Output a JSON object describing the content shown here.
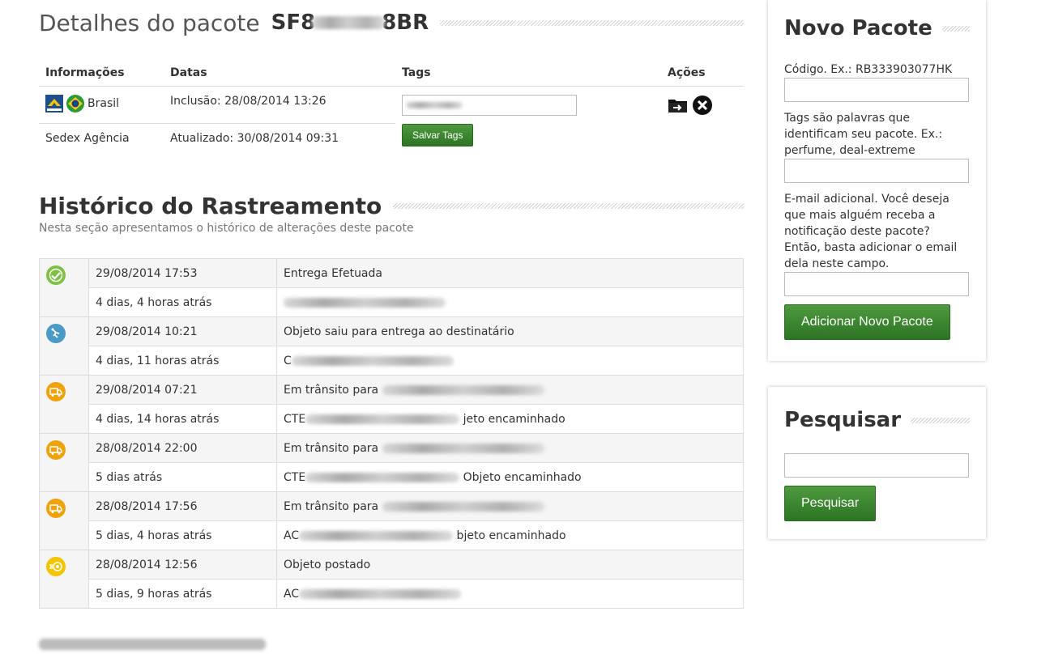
{
  "header": {
    "title": "Detalhes do pacote",
    "code_prefix": "SF8",
    "code_suffix": "8BR"
  },
  "info_table": {
    "headers": [
      "Informações",
      "Datas",
      "Tags",
      "Ações"
    ],
    "country": "Brasil",
    "service": "Sedex Agência",
    "inclusion": "Inclusão: 28/08/2014 13:26",
    "updated": "Atualizado: 30/08/2014 09:31",
    "save_tags_label": "Salvar Tags"
  },
  "history": {
    "title": "Histórico do Rastreamento",
    "subtitle": "Nesta seção apresentamos o histórico de alterações deste pacote",
    "events": [
      {
        "icon": "check-circle-icon",
        "color": "#7cc142",
        "date": "29/08/2014 17:53",
        "status": "Entrega Efetuada",
        "ago": "4 dias, 4 horas atrás",
        "detail_prefix": "",
        "detail_suffix": ""
      },
      {
        "icon": "delivery-person-icon",
        "color": "#4a9ac8",
        "date": "29/08/2014 10:21",
        "status": "Objeto saiu para entrega ao destinatário",
        "ago": "4 dias, 11 horas atrás",
        "detail_prefix": "C",
        "detail_suffix": ""
      },
      {
        "icon": "truck-icon",
        "color": "#f0a20a",
        "date": "29/08/2014 07:21",
        "status": "Em trânsito para",
        "ago": "4 dias, 14 horas atrás",
        "detail_prefix": "CTE",
        "detail_suffix": "jeto encaminhado"
      },
      {
        "icon": "truck-icon",
        "color": "#f0a20a",
        "date": "28/08/2014 22:00",
        "status": "Em trânsito para",
        "ago": "5 dias atrás",
        "detail_prefix": "CTE",
        "detail_suffix": "Objeto encaminhado"
      },
      {
        "icon": "truck-icon",
        "color": "#f0a20a",
        "date": "28/08/2014 17:56",
        "status": "Em trânsito para",
        "ago": "5 dias, 4 horas atrás",
        "detail_prefix": "AC",
        "detail_suffix": "bjeto encaminhado"
      },
      {
        "icon": "posted-icon",
        "color": "#f5c400",
        "date": "28/08/2014 12:56",
        "status": "Objeto postado",
        "ago": "5 dias, 9 horas atrás",
        "detail_prefix": "AC",
        "detail_suffix": ""
      }
    ]
  },
  "new_package": {
    "title": "Novo Pacote",
    "code_label": "Código. Ex.: RB333903077HK",
    "tags_label": "Tags são palavras que identificam seu pacote. Ex.: perfume, deal-extreme",
    "email_label": "E-mail adicional. Você deseja que mais alguém receba a notificação deste pacote? Então, basta adicionar o email dela neste campo.",
    "button": "Adicionar Novo Pacote"
  },
  "search": {
    "title": "Pesquisar",
    "button": "Pesquisar"
  }
}
